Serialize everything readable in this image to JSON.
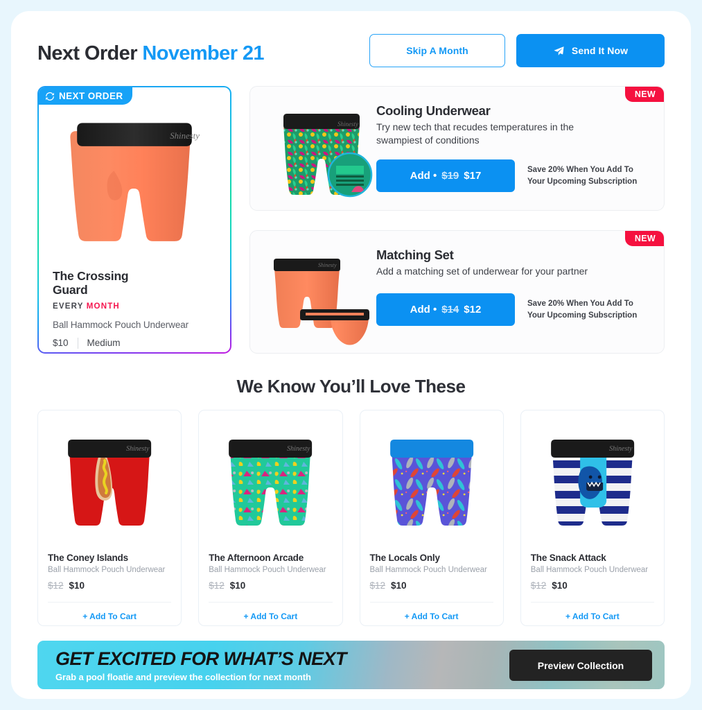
{
  "header": {
    "title_prefix": "Next Order",
    "title_date": "November 21",
    "skip_label": "Skip A Month",
    "send_label": "Send It Now",
    "send_icon": "paper-plane-icon",
    "accent_color": "#1499f5"
  },
  "next_order": {
    "badge_label": "NEXT ORDER",
    "badge_icon": "sync-refresh-icon",
    "product_name": "The Crossing Guard",
    "frequency_prefix": "EVERY",
    "frequency_value": "MONTH",
    "frequency_color": "#f5154e",
    "product_type": "Ball Hammock Pouch Underwear",
    "price": "$10",
    "size": "Medium",
    "image_alt": "orange-boxer-briefs"
  },
  "upsells": [
    {
      "badge": "NEW",
      "title": "Cooling Underwear",
      "description": "Try new tech that recudes temperatures in the swampiest of conditions",
      "add_prefix": "Add •",
      "price_was": "$19",
      "price_now": "$17",
      "save_note": "Save 20% When You Add To\nYour Upcoming Subscription",
      "image_alt": "tropical-print-boxer-briefs"
    },
    {
      "badge": "NEW",
      "title": "Matching Set",
      "description": "Add a matching set of underwear for your partner",
      "add_prefix": "Add •",
      "price_was": "$14",
      "price_now": "$12",
      "save_note": "Save 20% When You Add To\nYour Upcoming Subscription",
      "image_alt": "orange-matching-set"
    }
  ],
  "recommendations": {
    "heading": "We Know You’ll Love These",
    "add_label": "+ Add To Cart",
    "items": [
      {
        "name": "The Coney Islands",
        "type": "Ball Hammock Pouch Underwear",
        "price_old": "$12",
        "price_new": "$10",
        "image_alt": "red-hot-dog-print-boxer-briefs"
      },
      {
        "name": "The Afternoon Arcade",
        "type": "Ball Hammock Pouch Underwear",
        "price_old": "$12",
        "price_new": "$10",
        "image_alt": "green-90s-memphis-print-boxer-briefs"
      },
      {
        "name": "The Locals Only",
        "type": "Ball Hammock Pouch Underwear",
        "price_old": "$12",
        "price_new": "$10",
        "image_alt": "purple-surfboard-print-boxer-briefs"
      },
      {
        "name": "The Snack Attack",
        "type": "Ball Hammock Pouch Underwear",
        "price_old": "$12",
        "price_new": "$10",
        "image_alt": "navy-striped-shark-print-boxer-briefs"
      }
    ]
  },
  "banner": {
    "title": "GET EXCITED FOR WHAT’S NEXT",
    "subtitle": "Grab a pool floatie and preview the collection for next month",
    "button_label": "Preview Collection"
  }
}
